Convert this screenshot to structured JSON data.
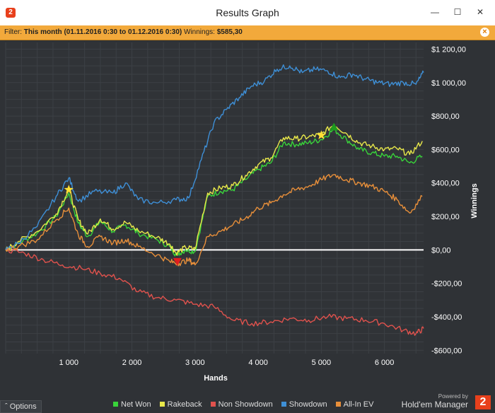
{
  "window": {
    "title": "Results Graph",
    "app_icon": "2"
  },
  "filter": {
    "label": "Filter:",
    "period": "This month (01.11.2016 0:30 to 01.12.2016 0:30)",
    "winnings_label": "Winnings:",
    "winnings_value": "$585,30",
    "close_icon": "x-circle-icon"
  },
  "footer": {
    "options_label": "Options",
    "options_icon": "caret-up-icon",
    "powered_by": "Powered by",
    "brand": "Hold'em Manager",
    "brand_logo": "2"
  },
  "colors": {
    "net_won": "#39d33a",
    "rakeback": "#e8e84a",
    "non_showdown": "#e0524d",
    "showdown": "#3e8fd6",
    "all_in_ev": "#e88f3a",
    "titlebar": "#ffffff",
    "filterbar": "#f2a93b",
    "background": "#2f3236"
  },
  "chart_data": {
    "type": "line",
    "xlabel": "Hands",
    "ylabel": "Winnings",
    "xlim": [
      0,
      6620
    ],
    "ylim": [
      -620,
      1240
    ],
    "x_ticks": [
      1000,
      2000,
      3000,
      4000,
      5000,
      6000
    ],
    "x_tick_labels": [
      "1 000",
      "2 000",
      "3 000",
      "4 000",
      "5 000",
      "6 000"
    ],
    "y_ticks": [
      -600,
      -400,
      -200,
      0,
      200,
      400,
      600,
      800,
      1000,
      1200
    ],
    "y_tick_labels": [
      "-$600,00",
      "-$400,00",
      "-$200,00",
      "$0,00",
      "$200,00",
      "$400,00",
      "$600,00",
      "$800,00",
      "$1 000,00",
      "$1 200,00"
    ],
    "grid": true,
    "legend_position": "bottom",
    "series": [
      {
        "name": "Net Won",
        "color": "#39d33a",
        "points": [
          [
            0,
            0
          ],
          [
            200,
            40
          ],
          [
            500,
            100
          ],
          [
            800,
            200
          ],
          [
            1000,
            340
          ],
          [
            1150,
            160
          ],
          [
            1300,
            80
          ],
          [
            1500,
            170
          ],
          [
            1700,
            110
          ],
          [
            1900,
            150
          ],
          [
            2100,
            100
          ],
          [
            2400,
            60
          ],
          [
            2600,
            20
          ],
          [
            2700,
            -30
          ],
          [
            2850,
            0
          ],
          [
            3000,
            -10
          ],
          [
            3200,
            320
          ],
          [
            3400,
            350
          ],
          [
            3600,
            360
          ],
          [
            3800,
            420
          ],
          [
            4000,
            480
          ],
          [
            4200,
            520
          ],
          [
            4400,
            640
          ],
          [
            4600,
            630
          ],
          [
            4800,
            640
          ],
          [
            5000,
            660
          ],
          [
            5200,
            720
          ],
          [
            5400,
            660
          ],
          [
            5600,
            600
          ],
          [
            5800,
            580
          ],
          [
            6000,
            560
          ],
          [
            6200,
            560
          ],
          [
            6400,
            520
          ],
          [
            6600,
            560
          ]
        ]
      },
      {
        "name": "Rakeback",
        "color": "#e8e84a",
        "points": [
          [
            0,
            0
          ],
          [
            200,
            50
          ],
          [
            500,
            110
          ],
          [
            800,
            215
          ],
          [
            1000,
            360
          ],
          [
            1150,
            180
          ],
          [
            1300,
            95
          ],
          [
            1500,
            185
          ],
          [
            1700,
            125
          ],
          [
            1900,
            165
          ],
          [
            2100,
            115
          ],
          [
            2400,
            75
          ],
          [
            2600,
            35
          ],
          [
            2700,
            -20
          ],
          [
            2850,
            15
          ],
          [
            3000,
            5
          ],
          [
            3200,
            340
          ],
          [
            3400,
            370
          ],
          [
            3600,
            385
          ],
          [
            3800,
            445
          ],
          [
            4000,
            510
          ],
          [
            4200,
            550
          ],
          [
            4400,
            670
          ],
          [
            4600,
            665
          ],
          [
            4800,
            675
          ],
          [
            5000,
            690
          ],
          [
            5200,
            750
          ],
          [
            5400,
            695
          ],
          [
            5600,
            640
          ],
          [
            5800,
            620
          ],
          [
            6000,
            600
          ],
          [
            6200,
            605
          ],
          [
            6400,
            570
          ],
          [
            6600,
            650
          ]
        ]
      },
      {
        "name": "Non Showdown",
        "color": "#e0524d",
        "points": [
          [
            0,
            0
          ],
          [
            300,
            -20
          ],
          [
            600,
            -60
          ],
          [
            900,
            -90
          ],
          [
            1200,
            -110
          ],
          [
            1500,
            -140
          ],
          [
            1800,
            -170
          ],
          [
            2100,
            -250
          ],
          [
            2400,
            -285
          ],
          [
            2700,
            -300
          ],
          [
            3000,
            -325
          ],
          [
            3300,
            -340
          ],
          [
            3600,
            -420
          ],
          [
            3900,
            -440
          ],
          [
            4200,
            -430
          ],
          [
            4500,
            -410
          ],
          [
            4800,
            -420
          ],
          [
            5100,
            -400
          ],
          [
            5400,
            -410
          ],
          [
            5700,
            -420
          ],
          [
            6000,
            -440
          ],
          [
            6300,
            -480
          ],
          [
            6500,
            -500
          ],
          [
            6620,
            -470
          ]
        ]
      },
      {
        "name": "Showdown",
        "color": "#3e8fd6",
        "points": [
          [
            0,
            0
          ],
          [
            200,
            40
          ],
          [
            500,
            140
          ],
          [
            800,
            320
          ],
          [
            1000,
            430
          ],
          [
            1150,
            290
          ],
          [
            1400,
            350
          ],
          [
            1700,
            340
          ],
          [
            1900,
            400
          ],
          [
            2100,
            300
          ],
          [
            2400,
            280
          ],
          [
            2700,
            300
          ],
          [
            2900,
            310
          ],
          [
            3100,
            540
          ],
          [
            3300,
            760
          ],
          [
            3500,
            840
          ],
          [
            3700,
            910
          ],
          [
            3900,
            980
          ],
          [
            4100,
            1010
          ],
          [
            4300,
            1080
          ],
          [
            4500,
            1100
          ],
          [
            4700,
            1060
          ],
          [
            4900,
            1080
          ],
          [
            5100,
            1070
          ],
          [
            5300,
            1030
          ],
          [
            5500,
            1050
          ],
          [
            5700,
            1020
          ],
          [
            5900,
            1000
          ],
          [
            6100,
            990
          ],
          [
            6300,
            1000
          ],
          [
            6500,
            990
          ],
          [
            6620,
            1060
          ]
        ]
      },
      {
        "name": "All-In EV",
        "color": "#e88f3a",
        "points": [
          [
            0,
            0
          ],
          [
            200,
            20
          ],
          [
            500,
            60
          ],
          [
            800,
            180
          ],
          [
            1000,
            250
          ],
          [
            1150,
            90
          ],
          [
            1300,
            20
          ],
          [
            1500,
            80
          ],
          [
            1700,
            40
          ],
          [
            1900,
            60
          ],
          [
            2100,
            20
          ],
          [
            2400,
            -30
          ],
          [
            2600,
            -70
          ],
          [
            2750,
            -80
          ],
          [
            2900,
            -60
          ],
          [
            3000,
            -90
          ],
          [
            3200,
            80
          ],
          [
            3400,
            110
          ],
          [
            3600,
            150
          ],
          [
            3800,
            190
          ],
          [
            4000,
            250
          ],
          [
            4200,
            280
          ],
          [
            4400,
            330
          ],
          [
            4600,
            360
          ],
          [
            4800,
            380
          ],
          [
            5000,
            420
          ],
          [
            5200,
            450
          ],
          [
            5400,
            420
          ],
          [
            5600,
            400
          ],
          [
            5800,
            380
          ],
          [
            6000,
            350
          ],
          [
            6200,
            300
          ],
          [
            6400,
            220
          ],
          [
            6600,
            320
          ]
        ]
      }
    ],
    "markers": [
      {
        "type": "star",
        "x": 1000,
        "y": 360,
        "color": "#ffe034"
      },
      {
        "type": "down-triangle",
        "x": 2720,
        "y": -70,
        "color": "#e01e1e"
      },
      {
        "type": "star",
        "x": 5000,
        "y": 685,
        "color": "#ffe034"
      },
      {
        "type": "up-triangle",
        "x": 5200,
        "y": 735,
        "color": "#1e9a1e"
      }
    ]
  }
}
